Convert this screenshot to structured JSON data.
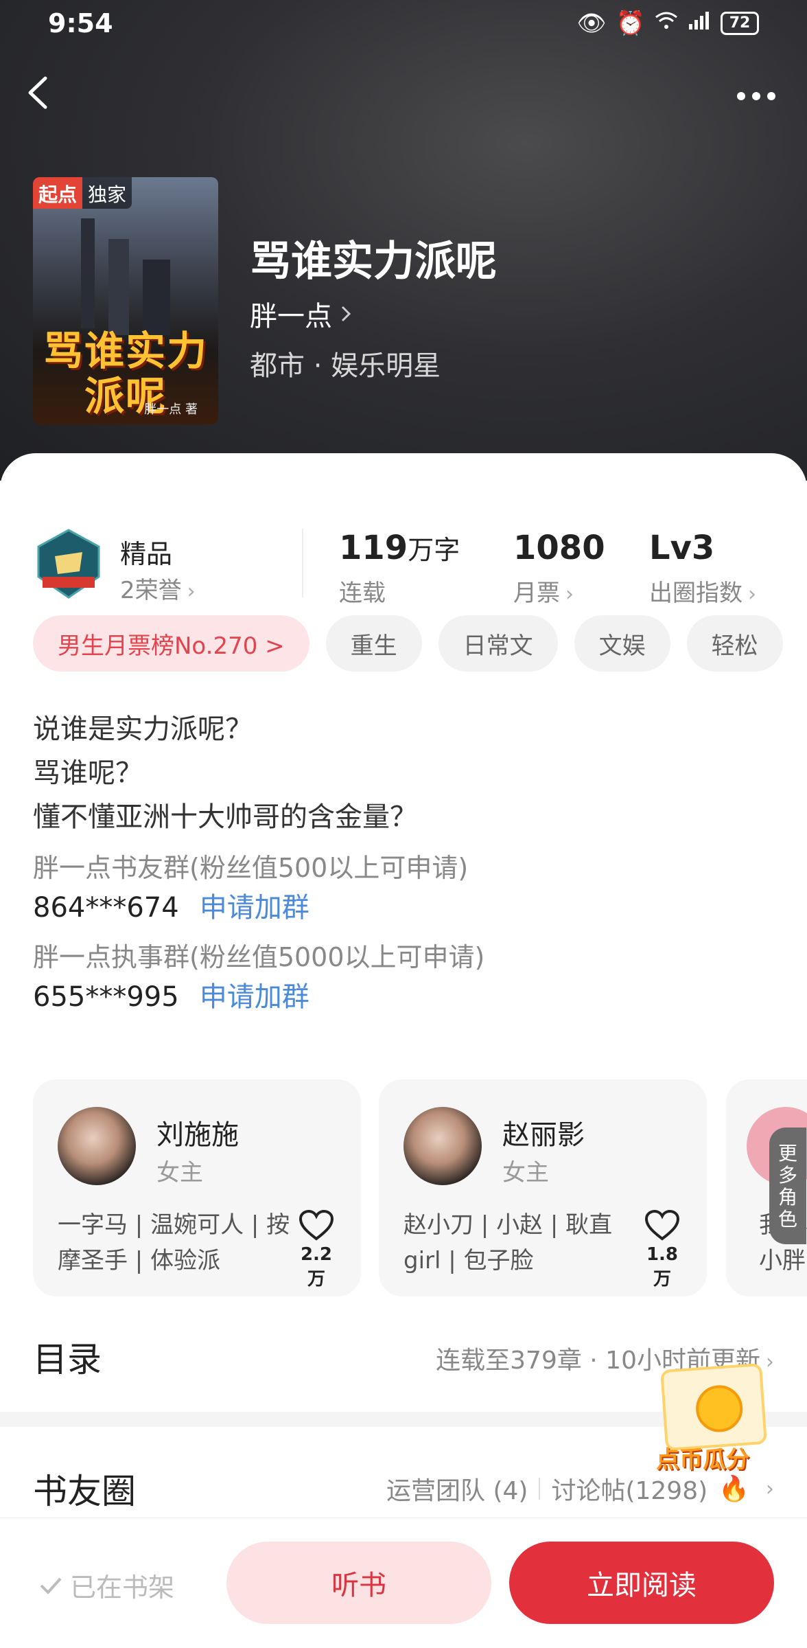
{
  "status": {
    "time": "9:54",
    "battery": "72"
  },
  "book": {
    "title": "骂谁实力派呢",
    "author": "胖一点",
    "genre": "都市 · 娱乐明星",
    "cover": {
      "badge_left": "起点",
      "badge_right": "独家",
      "title_text": "骂谁实力派呢",
      "author_text": "胖一点 著"
    }
  },
  "stats": {
    "quality_label": "精品",
    "honor_text": "2荣誉",
    "words_value": "119",
    "words_unit": "万字",
    "words_label": "连载",
    "monthly_value": "1080",
    "monthly_label": "月票",
    "level_value": "Lv3",
    "level_label": "出圈指数"
  },
  "tags": [
    "男生月票榜No.270 >",
    "重生",
    "日常文",
    "文娱",
    "轻松"
  ],
  "intro": {
    "lines": [
      "说谁是实力派呢？",
      "骂谁呢？",
      "懂不懂亚洲十大帅哥的含金量？"
    ],
    "group1_desc": "胖一点书友群(粉丝值500以上可申请)",
    "group1_num": "864***674",
    "group2_desc": "胖一点执事群(粉丝值5000以上可申请)",
    "group2_num": "655***995",
    "join_label": "申请加群"
  },
  "characters": [
    {
      "name": "刘施施",
      "role": "女主",
      "desc": "一字马 | 温婉可人 | 按摩圣手 | 体验派",
      "likes": "2.2万"
    },
    {
      "name": "赵丽影",
      "role": "女主",
      "desc": "赵小刀 | 小赵 | 耿直girl | 包子脸",
      "likes": "1.8万"
    }
  ],
  "more_characters": {
    "tab_label": "更多角色",
    "partial_desc": "我是小\n小胖"
  },
  "toc": {
    "title": "目录",
    "status": "连载至379章 · 10小时前更新"
  },
  "circle": {
    "title": "书友圈",
    "team": "运营团队 (4)",
    "posts": "讨论帖(1298)"
  },
  "promo": {
    "label": "点币瓜分"
  },
  "bottom": {
    "shelf": "已在书架",
    "listen": "听书",
    "read": "立即阅读"
  },
  "colors": {
    "accent": "#e2313d",
    "link": "#4a8ad8"
  }
}
